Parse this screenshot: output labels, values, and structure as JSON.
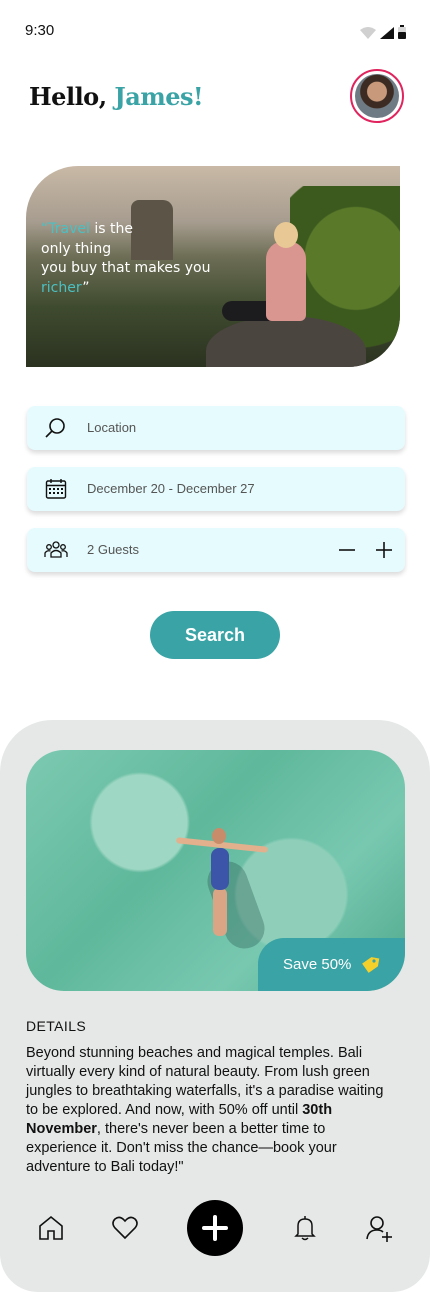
{
  "status_bar": {
    "time": "9:30"
  },
  "header": {
    "greeting": "Hello, ",
    "name": "James!"
  },
  "hero": {
    "quote_open": "“",
    "quote_word1": "Travel",
    "quote_line1_rest": " is the",
    "quote_line2": "only thing",
    "quote_line3": "you buy that makes you",
    "quote_word2": "richer",
    "quote_close": "”"
  },
  "search": {
    "location_placeholder": "Location",
    "dates_value": "December 20 -  December 27",
    "guests_value": "2 Guests",
    "guests_count": 2,
    "button_label": "Search"
  },
  "promo": {
    "badge_label": "Save 50%",
    "details_title": "DETAILS",
    "details_part1": "Beyond stunning beaches and magical temples. Bali virtually every kind of natural beauty. From lush green jungles to breathtaking waterfalls, it's a paradise waiting to be explored. And now, with 50% off until ",
    "details_bold": "30th November",
    "details_part2": ", there's never been a better time to experience it. Don't miss the chance—book your adventure to Bali today!\""
  },
  "nav": {
    "items": [
      "home-icon",
      "heart-icon",
      "plus-icon",
      "bell-icon",
      "add-user-icon"
    ],
    "accent": "#3aa3a5",
    "field_bg": "#e6fbfd"
  }
}
